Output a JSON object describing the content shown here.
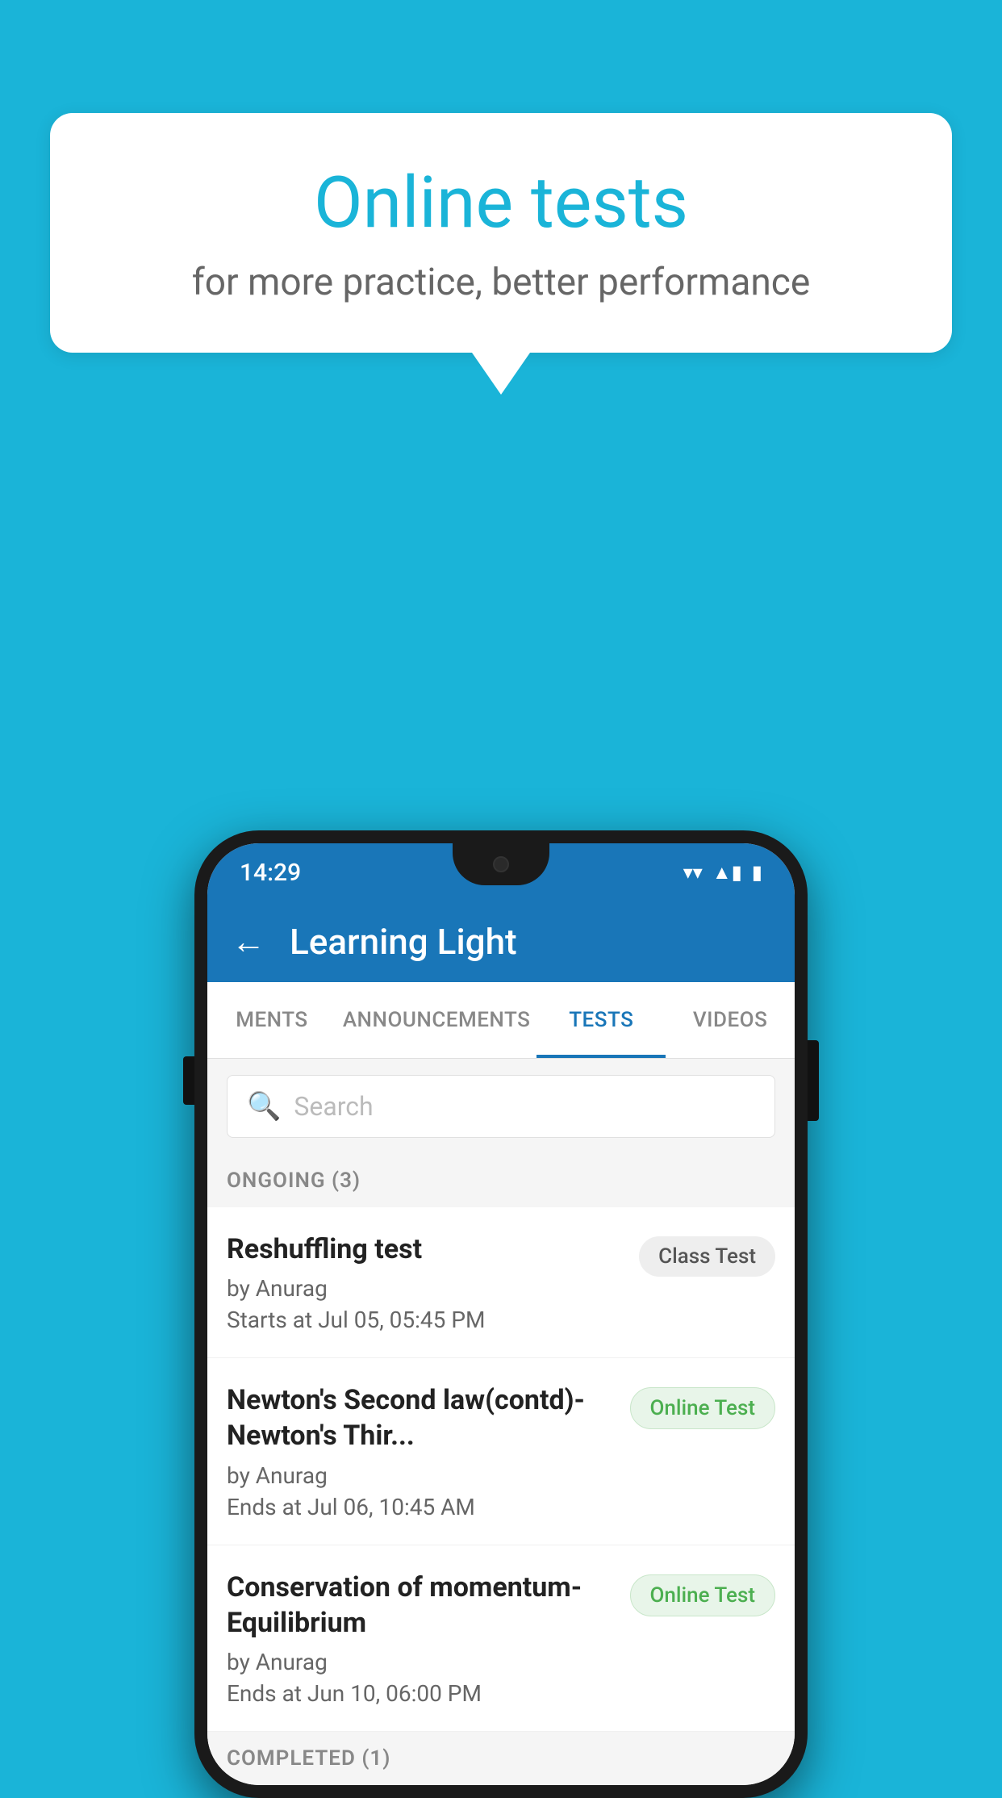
{
  "background_color": "#1ab4d8",
  "speech_bubble": {
    "title": "Online tests",
    "subtitle": "for more practice, better performance"
  },
  "status_bar": {
    "time": "14:29",
    "wifi": "▼",
    "signal": "▲",
    "battery": "▮"
  },
  "app_bar": {
    "title": "Learning Light",
    "back_label": "←"
  },
  "tabs": [
    {
      "label": "MENTS",
      "active": false
    },
    {
      "label": "ANNOUNCEMENTS",
      "active": false
    },
    {
      "label": "TESTS",
      "active": true
    },
    {
      "label": "VIDEOS",
      "active": false
    }
  ],
  "search": {
    "placeholder": "Search"
  },
  "ongoing_section": {
    "header": "ONGOING (3)",
    "tests": [
      {
        "title": "Reshuffling test",
        "author": "by Anurag",
        "time": "Starts at  Jul 05, 05:45 PM",
        "badge": "Class Test",
        "badge_type": "class"
      },
      {
        "title": "Newton's Second law(contd)-Newton's Thir...",
        "author": "by Anurag",
        "time": "Ends at  Jul 06, 10:45 AM",
        "badge": "Online Test",
        "badge_type": "online"
      },
      {
        "title": "Conservation of momentum-Equilibrium",
        "author": "by Anurag",
        "time": "Ends at  Jun 10, 06:00 PM",
        "badge": "Online Test",
        "badge_type": "online"
      }
    ]
  },
  "completed_section": {
    "header": "COMPLETED (1)"
  }
}
